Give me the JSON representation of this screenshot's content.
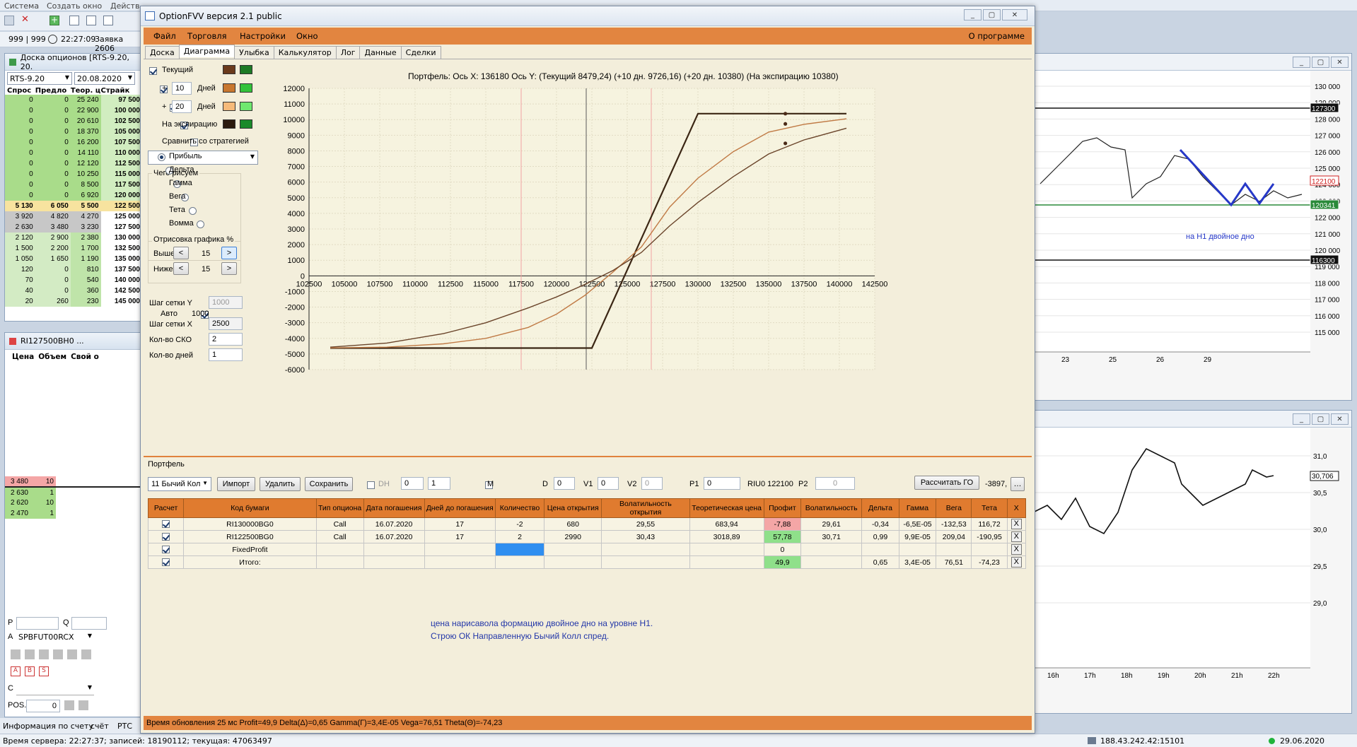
{
  "top_menu": [
    "Система",
    "Создать окно",
    "Действ"
  ],
  "left_top": {
    "counts": "999 | 999",
    "time": "22:27:09",
    "order": "Заявка 2606"
  },
  "board": {
    "title": "Доска опционов [RTS-9.20, 20.",
    "series": "RTS-9.20",
    "date": "20.08.2020",
    "headers": [
      "Спрос",
      "Предло",
      "Теор. ц",
      "Страйк"
    ],
    "rows": [
      [
        "0",
        "0",
        "25 240",
        "97 500"
      ],
      [
        "0",
        "0",
        "22 900",
        "100 000"
      ],
      [
        "0",
        "0",
        "20 610",
        "102 500"
      ],
      [
        "0",
        "0",
        "18 370",
        "105 000"
      ],
      [
        "0",
        "0",
        "16 200",
        "107 500"
      ],
      [
        "0",
        "0",
        "14 110",
        "110 000"
      ],
      [
        "0",
        "0",
        "12 120",
        "112 500"
      ],
      [
        "0",
        "0",
        "10 250",
        "115 000"
      ],
      [
        "0",
        "0",
        "8 500",
        "117 500"
      ],
      [
        "0",
        "0",
        "6 920",
        "120 000"
      ],
      [
        "5 130",
        "6 050",
        "5 500",
        "122 500"
      ],
      [
        "3 920",
        "4 820",
        "4 270",
        "125 000"
      ],
      [
        "2 630",
        "3 480",
        "3 230",
        "127 500"
      ],
      [
        "2 120",
        "2 900",
        "2 380",
        "130 000"
      ],
      [
        "1 500",
        "2 200",
        "1 700",
        "132 500"
      ],
      [
        "1 050",
        "1 650",
        "1 190",
        "135 000"
      ],
      [
        "120",
        "0",
        "810",
        "137 500"
      ],
      [
        "70",
        "0",
        "540",
        "140 000"
      ],
      [
        "40",
        "0",
        "360",
        "142 500"
      ],
      [
        "20",
        "260",
        "230",
        "145 000"
      ]
    ]
  },
  "glass": {
    "title": "RI127500BH0 ...",
    "headers": [
      "Цена",
      "Объем",
      "Свой о"
    ],
    "rows": [
      [
        "3 480",
        "10"
      ],
      [
        "2 630",
        "1"
      ],
      [
        "2 620",
        "10"
      ],
      [
        "2 470",
        "1"
      ]
    ],
    "p_label": "P",
    "q_label": "Q",
    "a_label": "A",
    "account": "SPBFUT00RCX",
    "c_label": "C",
    "pos_label": "POS.",
    "pos_value": "0"
  },
  "bottom_tabs": [
    "Информация по счету",
    "счёт",
    "РТС"
  ],
  "status_left": "Время сервера: 22:27:37; записей: 18190112; текущая: 47063497",
  "status_ip": "188.43.242.42:15101",
  "status_date": "29.06.2020",
  "price_chart": {
    "levels": [
      "130 000",
      "129 000",
      "128 000",
      "127 000",
      "126 000",
      "125 000",
      "124 000",
      "123 000",
      "122 000",
      "121 000",
      "120 000",
      "119 000",
      "118 000",
      "117 000",
      "116 000",
      "115 000"
    ],
    "marks": {
      "top": "127300",
      "price": "122100",
      "green": "120341",
      "bottom": "116300"
    },
    "xlabels": [
      "23",
      "25",
      "26",
      "29"
    ],
    "note": "на Н1 двойное дно"
  },
  "vol_chart": {
    "levels": [
      "31,0",
      "30,5",
      "30,0",
      "29,5",
      "29,0"
    ],
    "mark": "30,706",
    "xlabels": [
      "16h",
      "17h",
      "18h",
      "19h",
      "20h",
      "21h",
      "22h"
    ]
  },
  "app": {
    "title": "OptionFVV версия 2.1 public",
    "menu": [
      "Файл",
      "Торговля",
      "Настройки",
      "Окно"
    ],
    "about": "О программе",
    "tabs": [
      "Доска",
      "Диаграмма",
      "Улыбка",
      "Калькулятор",
      "Лог",
      "Данные",
      "Сделки"
    ],
    "left": {
      "current": "Текущий",
      "plus": "+",
      "days1": "10",
      "days2": "20",
      "days_label": "Дней",
      "expiration": "На экспирацию",
      "compare": "Сравнить со стратегией",
      "what": "Чего рисуем",
      "options": [
        "Прибыль",
        "Дельта",
        "Гамма",
        "Вега",
        "Тета",
        "Вомма"
      ],
      "render_pct": "Отрисовка графика %",
      "above": "Выше",
      "below": "Ниже",
      "above_v": "15",
      "below_v": "15",
      "grid_y": "Шаг сетки Y",
      "grid_y_v": "1000",
      "auto": "Авто",
      "auto_v": "1000",
      "grid_x": "Шаг сетки X",
      "grid_x_v": "2500",
      "sko": "Кол-во СКО",
      "sko_v": "2",
      "ndays": "Кол-во дней",
      "ndays_v": "1"
    },
    "chart_header": "Портфель: Ось X: 136180 Ось Y:  (Текущий 8479,24)  (+10 дн. 9726,16)  (+20 дн. 10380)  (На экспирацию 10380)",
    "portfolio": {
      "label": "Портфель",
      "name": "11 Бычий Кол",
      "import": "Импорт",
      "delete": "Удалить",
      "save": "Сохранить",
      "dh": "DH",
      "n1": "0",
      "n2": "1",
      "m": "M",
      "d": "D",
      "d_v": "0",
      "v1": "V1",
      "v1_v": "0",
      "v2": "V2",
      "v2_v": "0",
      "p1": "P1",
      "p1_v": "0",
      "riu": "RIU0 122100",
      "p2": "P2",
      "p2_v": "0",
      "calc": "Рассчитать ГО",
      "go_v": "-3897,",
      "headers": [
        "Расчет",
        "Код бумаги",
        "Тип опциона",
        "Дата погашения",
        "Дней до погашения",
        "Количество",
        "Цена открытия",
        "Волатильность открытия",
        "Теоретическая цена",
        "Профит",
        "Волатильность",
        "Дельта",
        "Гамма",
        "Вега",
        "Тета",
        "X"
      ],
      "rows": [
        [
          "RI130000BG0",
          "Call",
          "16.07.2020",
          "17",
          "-2",
          "680",
          "29,55",
          "683,94",
          "-7,88",
          "29,61",
          "-0,34",
          "-6,5E-05",
          "-132,53",
          "116,72"
        ],
        [
          "RI122500BG0",
          "Call",
          "16.07.2020",
          "17",
          "2",
          "2990",
          "30,43",
          "3018,89",
          "57,78",
          "30,71",
          "0,99",
          "9,9E-05",
          "209,04",
          "-190,95"
        ],
        [
          "FixedProfit",
          "",
          "",
          "",
          "",
          "",
          "",
          "",
          "0",
          "",
          "",
          "",
          "",
          ""
        ],
        [
          "Итого:",
          "",
          "",
          "",
          "",
          "",
          "",
          "",
          "49,9",
          "",
          "0,65",
          "3,4E-05",
          "76,51",
          "-74,23"
        ]
      ],
      "note1": "цена нарисавола формацию двойное дно на уровне Н1.",
      "note2": "Строю ОК Направленную Бычий Колл спред."
    },
    "status": "Время обновления 25 мс  Profit=49,9 Delta(Δ)=0,65 Gamma(Γ)=3,4E-05 Vega=76,51 Theta(Θ)=-74,23"
  },
  "chart_data": {
    "type": "line",
    "title": "Портфель: Ось X: 136180 Ось Y:  (Текущий 8479,24)  (+10 дн. 9726,16)  (+20 дн. 10380)  (На экспирацию 10380)",
    "xlim": [
      102500,
      142500
    ],
    "ylim": [
      -6000,
      12000
    ],
    "xticks": [
      102500,
      105000,
      107500,
      110000,
      112500,
      115000,
      117500,
      120000,
      122500,
      125000,
      127500,
      130000,
      132500,
      135000,
      137500,
      140000,
      142500
    ],
    "yticks": [
      12000,
      11000,
      10000,
      9000,
      8000,
      7000,
      6000,
      5000,
      4000,
      3000,
      2000,
      1000,
      0,
      -1000,
      -2000,
      -3000,
      -4000,
      -5000,
      -6000
    ],
    "grid": true,
    "series": [
      {
        "name": "На экспирацию",
        "color": "#3b2614",
        "x": [
          104000,
          122500,
          130000,
          140500
        ],
        "y": [
          -4620,
          -4620,
          10380,
          10380
        ]
      },
      {
        "name": "+20 дн.",
        "color": "#c07a45",
        "x": [
          104000,
          108000,
          112000,
          115000,
          118000,
          120000,
          122000,
          124000,
          126000,
          128000,
          130000,
          132500,
          135000,
          137500,
          140500
        ],
        "y": [
          -4610,
          -4560,
          -4350,
          -4000,
          -3300,
          -2450,
          -1250,
          250,
          1850,
          4400,
          6250,
          7950,
          9200,
          9700,
          10050
        ]
      },
      {
        "name": "Текущий",
        "color": "#6a442a",
        "x": [
          104000,
          108000,
          112000,
          115000,
          118000,
          120000,
          122000,
          124000,
          126000,
          128000,
          130000,
          132500,
          135000,
          137500,
          140500
        ],
        "y": [
          -4560,
          -4300,
          -3700,
          -3000,
          -2050,
          -1350,
          -550,
          350,
          1500,
          3200,
          4700,
          6350,
          7800,
          8700,
          9450
        ]
      }
    ],
    "vlines": [
      {
        "x": 117500,
        "color": "#f2a3a3"
      },
      {
        "x": 122100,
        "color": "#5a5a5a"
      },
      {
        "x": 126700,
        "color": "#f2a3a3"
      }
    ],
    "points": [
      {
        "x": 136180,
        "y": 10380
      },
      {
        "x": 136180,
        "y": 9726.16
      },
      {
        "x": 136180,
        "y": 8479.24
      }
    ]
  },
  "colors": {
    "accent": "#e07b2f",
    "panel": "#f3eedb",
    "board_green": "#a9dc8a",
    "board_sel": "#f7e39f",
    "loss": "#f4a6a6",
    "profit": "#8fe08a"
  }
}
